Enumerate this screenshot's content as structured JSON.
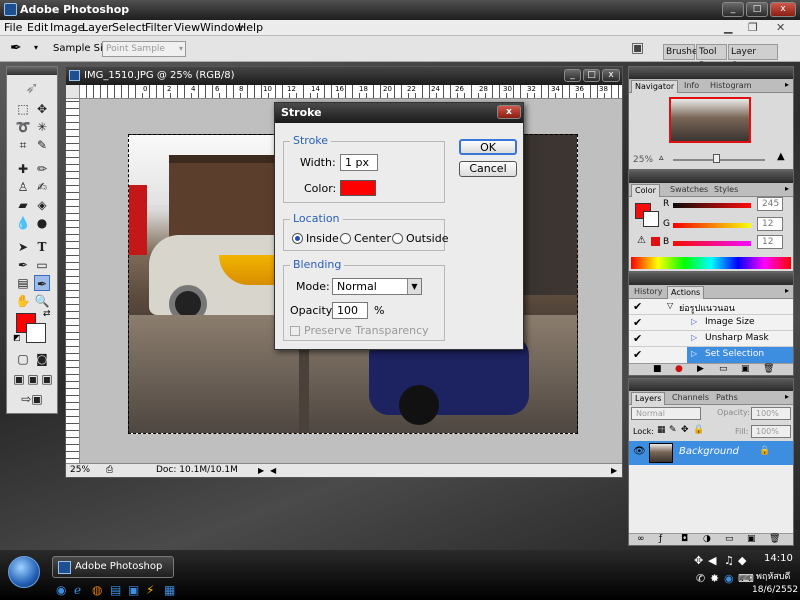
{
  "window": {
    "title": "Adobe Photoshop",
    "minimize": "_",
    "maximize": "□",
    "close": "x"
  },
  "menu": [
    "File",
    "Edit",
    "Image",
    "Layer",
    "Select",
    "Filter",
    "View",
    "Window",
    "Help"
  ],
  "options": {
    "sample_size_label": "Sample Size:",
    "sample_size_value": "Point Sample",
    "tabs": [
      "Brushes",
      "Tool Pr",
      "Layer Comps"
    ]
  },
  "document": {
    "title": "IMG_1510.JPG @ 25% (RGB/8)",
    "ruler_labels": [
      "0",
      "2",
      "4",
      "6",
      "8",
      "10",
      "12",
      "14",
      "16",
      "18",
      "20",
      "22",
      "24",
      "26",
      "28",
      "30",
      "32",
      "34",
      "36",
      "38"
    ],
    "zoom": "25%",
    "doc_size": "Doc: 10.1M/10.1M"
  },
  "dialog": {
    "title": "Stroke",
    "stroke_legend": "Stroke",
    "width_label": "Width:",
    "width_value": "1 px",
    "color_label": "Color:",
    "stroke_color": "#ff0000",
    "location_legend": "Location",
    "location_options": [
      "Inside",
      "Center",
      "Outside"
    ],
    "location_selected": "Inside",
    "blending_legend": "Blending",
    "mode_label": "Mode:",
    "mode_value": "Normal",
    "opacity_label": "Opacity:",
    "opacity_value": "100",
    "opacity_unit": "%",
    "preserve_label": "Preserve Transparency",
    "ok": "OK",
    "cancel": "Cancel"
  },
  "navigator": {
    "tabs": [
      "Navigator",
      "Info",
      "Histogram"
    ],
    "zoom": "25%"
  },
  "color_panel": {
    "tabs": [
      "Color",
      "Swatches",
      "Styles"
    ],
    "channels": [
      {
        "label": "R",
        "value": "245"
      },
      {
        "label": "G",
        "value": "12"
      },
      {
        "label": "B",
        "value": "12"
      }
    ],
    "foreground": "#f50c0c"
  },
  "actions_panel": {
    "tabs": [
      "History",
      "Actions"
    ],
    "items": [
      "ย่อรูปแนวนอน",
      "Image Size",
      "Unsharp Mask",
      "Set Selection"
    ],
    "selected": "Set Selection"
  },
  "layers_panel": {
    "tabs": [
      "Layers",
      "Channels",
      "Paths"
    ],
    "blend_mode": "Normal",
    "opacity_label": "Opacity:",
    "opacity_value": "100%",
    "lock_label": "Lock:",
    "fill_label": "Fill:",
    "fill_value": "100%",
    "layer_name": "Background"
  },
  "taskbar": {
    "task": "Adobe Photoshop",
    "time": "14:10",
    "day": "พฤหัสบดี",
    "date": "18/6/2552"
  },
  "colors": {
    "accent_blue": "#3d8de0",
    "foreground_red": "#ff0000"
  }
}
